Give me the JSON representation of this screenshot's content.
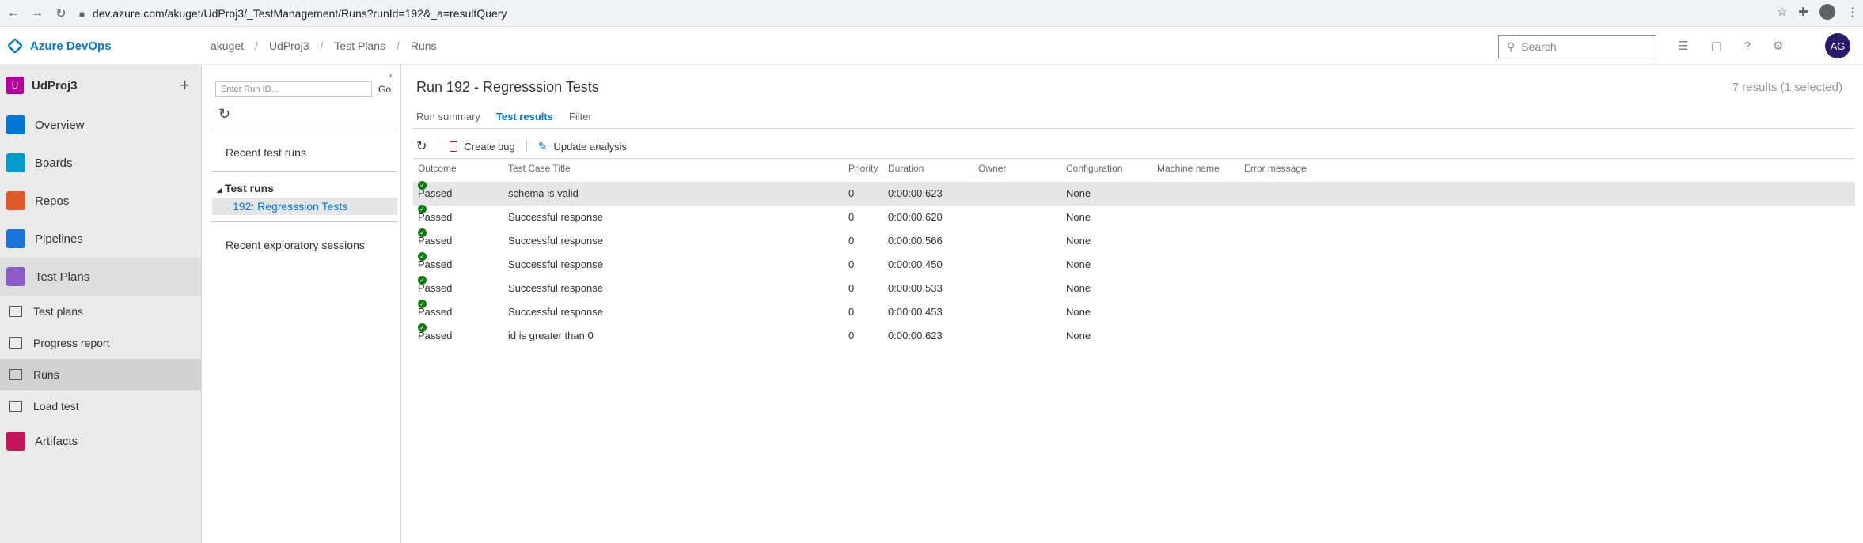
{
  "browser": {
    "url": "dev.azure.com/akuget/UdProj3/_TestManagement/Runs?runId=192&_a=resultQuery"
  },
  "header": {
    "brand": "Azure DevOps",
    "breadcrumb": [
      "akuget",
      "UdProj3",
      "Test Plans",
      "Runs"
    ],
    "search_placeholder": "Search",
    "user_initials": "AG"
  },
  "sidebar": {
    "project_badge": "U",
    "project_name": "UdProj3",
    "items": [
      {
        "label": "Overview"
      },
      {
        "label": "Boards"
      },
      {
        "label": "Repos"
      },
      {
        "label": "Pipelines"
      },
      {
        "label": "Test Plans"
      }
    ],
    "subitems": [
      {
        "label": "Test plans"
      },
      {
        "label": "Progress report"
      },
      {
        "label": "Runs"
      },
      {
        "label": "Load test"
      }
    ],
    "artifacts_label": "Artifacts"
  },
  "midpanel": {
    "runid_placeholder": "Enter Run ID...",
    "go_label": "Go",
    "recent_runs_label": "Recent test runs",
    "test_runs_label": "Test runs",
    "run_item": "192: Regresssion Tests",
    "recent_exploratory_label": "Recent exploratory sessions"
  },
  "main": {
    "title": "Run 192 - Regresssion Tests",
    "results_count": "7 results (1 selected)",
    "tabs": [
      "Run summary",
      "Test results",
      "Filter"
    ],
    "toolbar": {
      "create_bug": "Create bug",
      "update_analysis": "Update analysis"
    },
    "columns": {
      "outcome": "Outcome",
      "title": "Test Case Title",
      "priority": "Priority",
      "duration": "Duration",
      "owner": "Owner",
      "configuration": "Configuration",
      "machine": "Machine name",
      "error": "Error message"
    },
    "rows": [
      {
        "outcome": "Passed",
        "title": "schema is valid",
        "priority": "0",
        "duration": "0:00:00.623",
        "config": "None"
      },
      {
        "outcome": "Passed",
        "title": "Successful response",
        "priority": "0",
        "duration": "0:00:00.620",
        "config": "None"
      },
      {
        "outcome": "Passed",
        "title": "Successful response",
        "priority": "0",
        "duration": "0:00:00.566",
        "config": "None"
      },
      {
        "outcome": "Passed",
        "title": "Successful response",
        "priority": "0",
        "duration": "0:00:00.450",
        "config": "None"
      },
      {
        "outcome": "Passed",
        "title": "Successful response",
        "priority": "0",
        "duration": "0:00:00.533",
        "config": "None"
      },
      {
        "outcome": "Passed",
        "title": "Successful response",
        "priority": "0",
        "duration": "0:00:00.453",
        "config": "None"
      },
      {
        "outcome": "Passed",
        "title": "id is greater than 0",
        "priority": "0",
        "duration": "0:00:00.623",
        "config": "None"
      }
    ]
  }
}
